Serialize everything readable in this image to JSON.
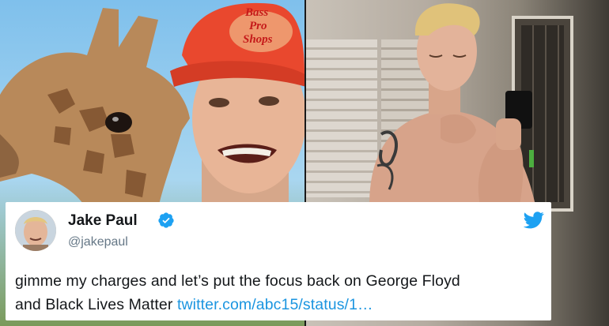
{
  "tweet": {
    "display_name": "Jake Paul",
    "handle": "@jakepaul",
    "text_line1": "gimme my charges and let’s put the focus back on George Floyd",
    "text_line2_prefix": "and Black Lives Matter ",
    "link": "twitter.com/abc15/status/1…",
    "verified_icon": "verified-badge-icon",
    "platform_icon": "twitter-bird-icon",
    "link_color": "#1b95e0",
    "verified_color": "#1da1f2"
  },
  "photos": {
    "left": {
      "hat_text_line1": "Bass",
      "hat_text_line2": "Pro",
      "hat_text_line3": "Shops"
    },
    "right": {}
  }
}
